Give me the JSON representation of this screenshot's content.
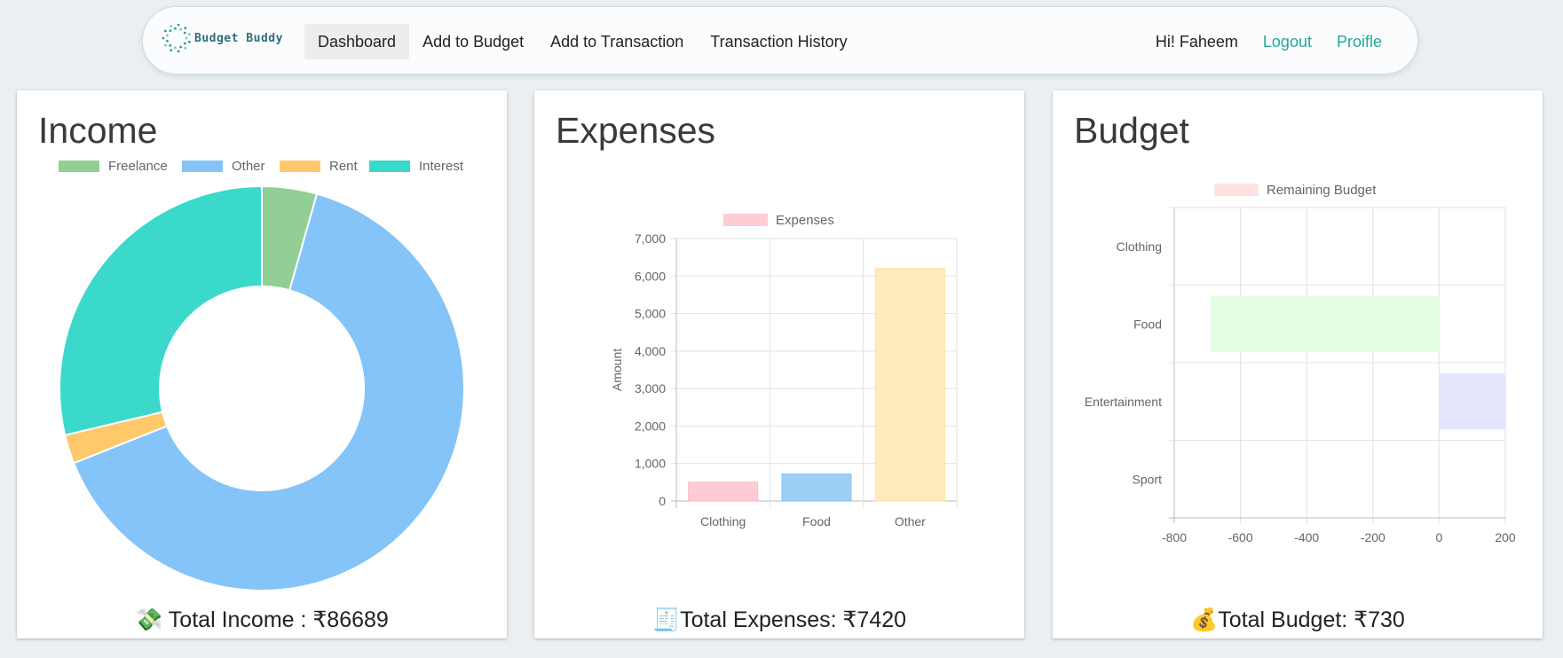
{
  "navbar": {
    "brand": "Budget Buddy",
    "links": [
      "Dashboard",
      "Add to Budget",
      "Add to Transaction",
      "Transaction History"
    ],
    "active_link": "Dashboard",
    "greeting": "Hi! Faheem",
    "logout": "Logout",
    "profile": "Proifle"
  },
  "cards": {
    "income": {
      "title": "Income",
      "total_icon": "money-with-wings-icon",
      "total": "💸 Total Income : ₹86689"
    },
    "expenses": {
      "title": "Expenses",
      "total_icon": "receipt-icon",
      "total": "🧾Total Expenses: ₹7420"
    },
    "budget": {
      "title": "Budget",
      "total_icon": "money-bag-icon",
      "total": "💰Total Budget: ₹730"
    }
  },
  "chart_data": [
    {
      "type": "pie",
      "variant": "doughnut",
      "labels": [
        "Freelance",
        "Other",
        "Rent",
        "Interest"
      ],
      "values": [
        3800,
        56000,
        2000,
        24889
      ],
      "colors": [
        "#93cf95",
        "#84c4f8",
        "#ffc86b",
        "#3bd8cc"
      ],
      "legend": "top"
    },
    {
      "type": "bar",
      "categories": [
        "Clothing",
        "Food",
        "Other"
      ],
      "series": [
        {
          "name": "Expenses",
          "values": [
            500,
            720,
            6200
          ]
        }
      ],
      "bar_colors": [
        "#ffcbd5",
        "#9dd0f5",
        "#ffebbd"
      ],
      "bar_borders": [
        "#ffb3c2",
        "#82c2f0",
        "#ffe0a0"
      ],
      "ylabel": "Amount",
      "ylim": [
        0,
        7000
      ],
      "yticks": [
        "0",
        "1,000",
        "2,000",
        "3,000",
        "4,000",
        "5,000",
        "6,000",
        "7,000"
      ],
      "grid": true,
      "legend": "top"
    },
    {
      "type": "bar",
      "orientation": "horizontal",
      "categories": [
        "Clothing",
        "Food",
        "Entertainment",
        "Sport"
      ],
      "series": [
        {
          "name": "Remaining Budget",
          "values": [
            0,
            -690,
            200,
            0
          ]
        }
      ],
      "bar_colors": [
        "#ffe5e5",
        "#e2fde3",
        "#e5e5fd",
        "#ffe5e5"
      ],
      "legend_color": "#ffe3e3",
      "xlim": [
        -800,
        200
      ],
      "xticks": [
        "-800",
        "-600",
        "-400",
        "-200",
        "0",
        "200"
      ],
      "grid": true,
      "legend": "top"
    }
  ]
}
